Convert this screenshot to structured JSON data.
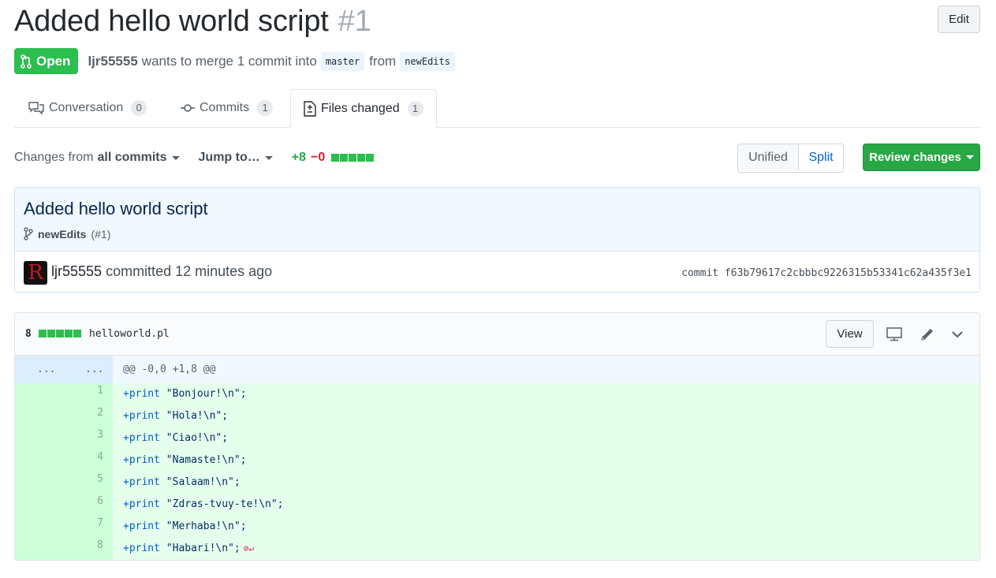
{
  "pr": {
    "title": "Added hello world script",
    "number": "#1",
    "edit_label": "Edit",
    "state": "Open",
    "author": "ljr55555",
    "merge_text": "wants to merge 1 commit into",
    "base_branch": "master",
    "from_text": "from",
    "head_branch": "newEdits"
  },
  "tabs": [
    {
      "label": "Conversation",
      "count": "0"
    },
    {
      "label": "Commits",
      "count": "1"
    },
    {
      "label": "Files changed",
      "count": "1"
    }
  ],
  "toolbar": {
    "changes_from": "Changes from",
    "all_commits": "all commits",
    "jump_to": "Jump to…",
    "additions": "+8",
    "deletions": "−0",
    "unified": "Unified",
    "split": "Split",
    "review": "Review changes"
  },
  "commit": {
    "title": "Added hello world script",
    "branch": "newEdits",
    "pr_ref": "(#1)",
    "avatar_letter": "R",
    "author": "ljr55555",
    "action": "committed 12 minutes ago",
    "sha_text": "commit f63b79617c2cbbbc9226315b53341c62a435f3e1"
  },
  "file": {
    "change_count": "8",
    "name": "helloworld.pl",
    "view_label": "View",
    "hunk_left": "...",
    "hunk_right": "...",
    "hunk_header": "@@ -0,0 +1,8 @@",
    "lines": [
      {
        "num": "1",
        "kw": "+print",
        "str": " \"Bonjour!\\n\";"
      },
      {
        "num": "2",
        "kw": "+print",
        "str": " \"Hola!\\n\";"
      },
      {
        "num": "3",
        "kw": "+print",
        "str": " \"Ciao!\\n\";"
      },
      {
        "num": "4",
        "kw": "+print",
        "str": " \"Namaste!\\n\";"
      },
      {
        "num": "5",
        "kw": "+print",
        "str": " \"Salaam!\\n\";"
      },
      {
        "num": "6",
        "kw": "+print",
        "str": " \"Zdras-tvuy-te!\\n\";"
      },
      {
        "num": "7",
        "kw": "+print",
        "str": " \"Merhaba!\\n\";"
      },
      {
        "num": "8",
        "kw": "+print",
        "str": " \"Habari!\\n\";"
      }
    ]
  },
  "colors": {
    "open_green": "#2cbe4e",
    "review_green": "#28a745",
    "addition_bg": "#e6ffed",
    "hunk_bg": "#f1f8ff",
    "link_blue": "#0366d6"
  },
  "icons": {
    "state": "git-pull-request-icon",
    "conversation": "comment-discussion-icon",
    "commits": "git-commit-icon",
    "files": "file-diff-icon",
    "branch": "git-branch-icon",
    "display": "desktop-icon",
    "edit": "pencil-icon",
    "collapse": "chevron-down-icon",
    "no_newline": "no-newline-icon"
  }
}
